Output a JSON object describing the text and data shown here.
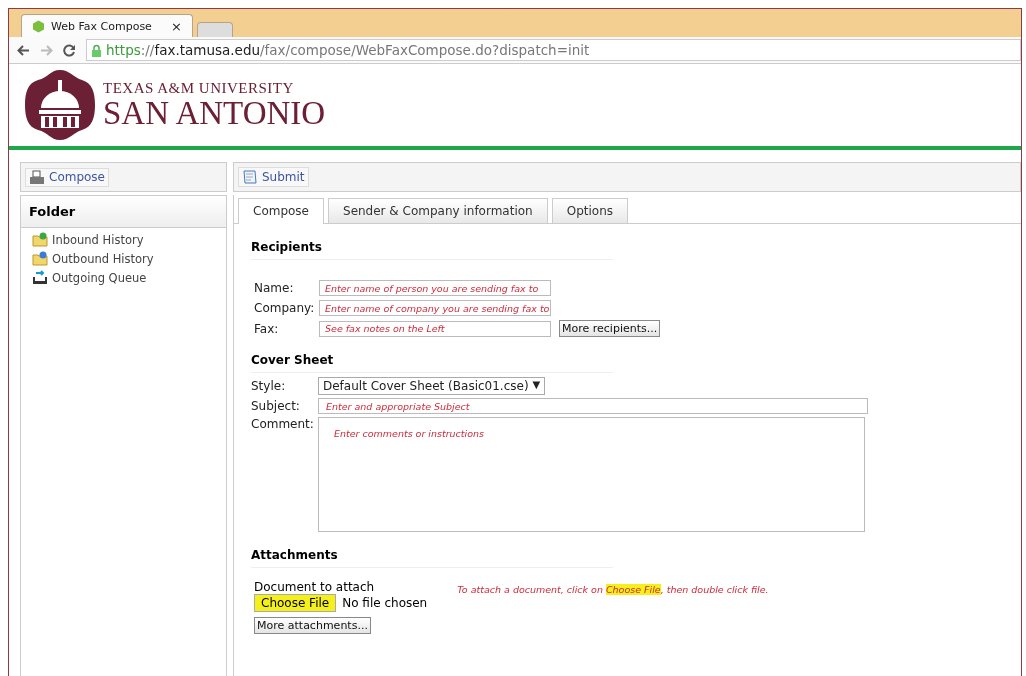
{
  "browser": {
    "tabs": [
      {
        "title": "Web Fax Compose",
        "close": "×",
        "selected": true
      },
      {
        "selected": false
      }
    ],
    "url_parts": [
      {
        "kind": "scheme",
        "text": "https"
      },
      {
        "kind": "sep",
        "text": "://"
      },
      {
        "kind": "host",
        "text": "fax.tamusa.edu"
      },
      {
        "kind": "path",
        "text": "/fax/compose/WebFaxCompose.do?dispatch=init"
      }
    ]
  },
  "logo": {
    "line1": "TEXAS A&M UNIVERSITY",
    "line2": "SAN ANTONIO"
  },
  "sidebar": {
    "button": "Compose",
    "title": "Folder",
    "items": [
      {
        "label": "Inbound History",
        "kind": "inbound"
      },
      {
        "label": "Outbound History",
        "kind": "outbound"
      },
      {
        "label": "Outgoing Queue",
        "kind": "queue"
      }
    ]
  },
  "toolbar": {
    "button": "Submit"
  },
  "tabs": [
    {
      "label": "Compose",
      "selected": true
    },
    {
      "label": "Sender & Company information",
      "selected": false
    },
    {
      "label": "Options",
      "selected": false
    }
  ],
  "recipients": {
    "heading": "Recipients",
    "fields": [
      {
        "label": "Name:",
        "value": "Enter name of person you are sending fax to"
      },
      {
        "label": "Company:",
        "value": "Enter name of company you are sending fax to"
      },
      {
        "label": "Fax:",
        "value": "See fax notes on the Left"
      }
    ],
    "more_button": "More recipients..."
  },
  "cover_sheet": {
    "heading": "Cover Sheet",
    "style": {
      "label": "Style:",
      "value": "Default Cover Sheet (Basic01.cse)",
      "caret": "▼"
    },
    "subject": {
      "label": "Subject:",
      "value": "Enter and appropriate Subject"
    },
    "comment": {
      "label": "Comment:",
      "value": "Enter comments or instructions"
    }
  },
  "attachments": {
    "heading": "Attachments",
    "label": "Document to attach",
    "choose_button": {
      "text": "Choose File",
      "highlighted": true
    },
    "status": "No file chosen",
    "note": [
      {
        "text": "To attach a document, click on ",
        "highlighted": false
      },
      {
        "text": "Choose File",
        "highlighted": true
      },
      {
        "text": ", then double click file.",
        "highlighted": false
      }
    ],
    "more_button": "More attachments..."
  }
}
